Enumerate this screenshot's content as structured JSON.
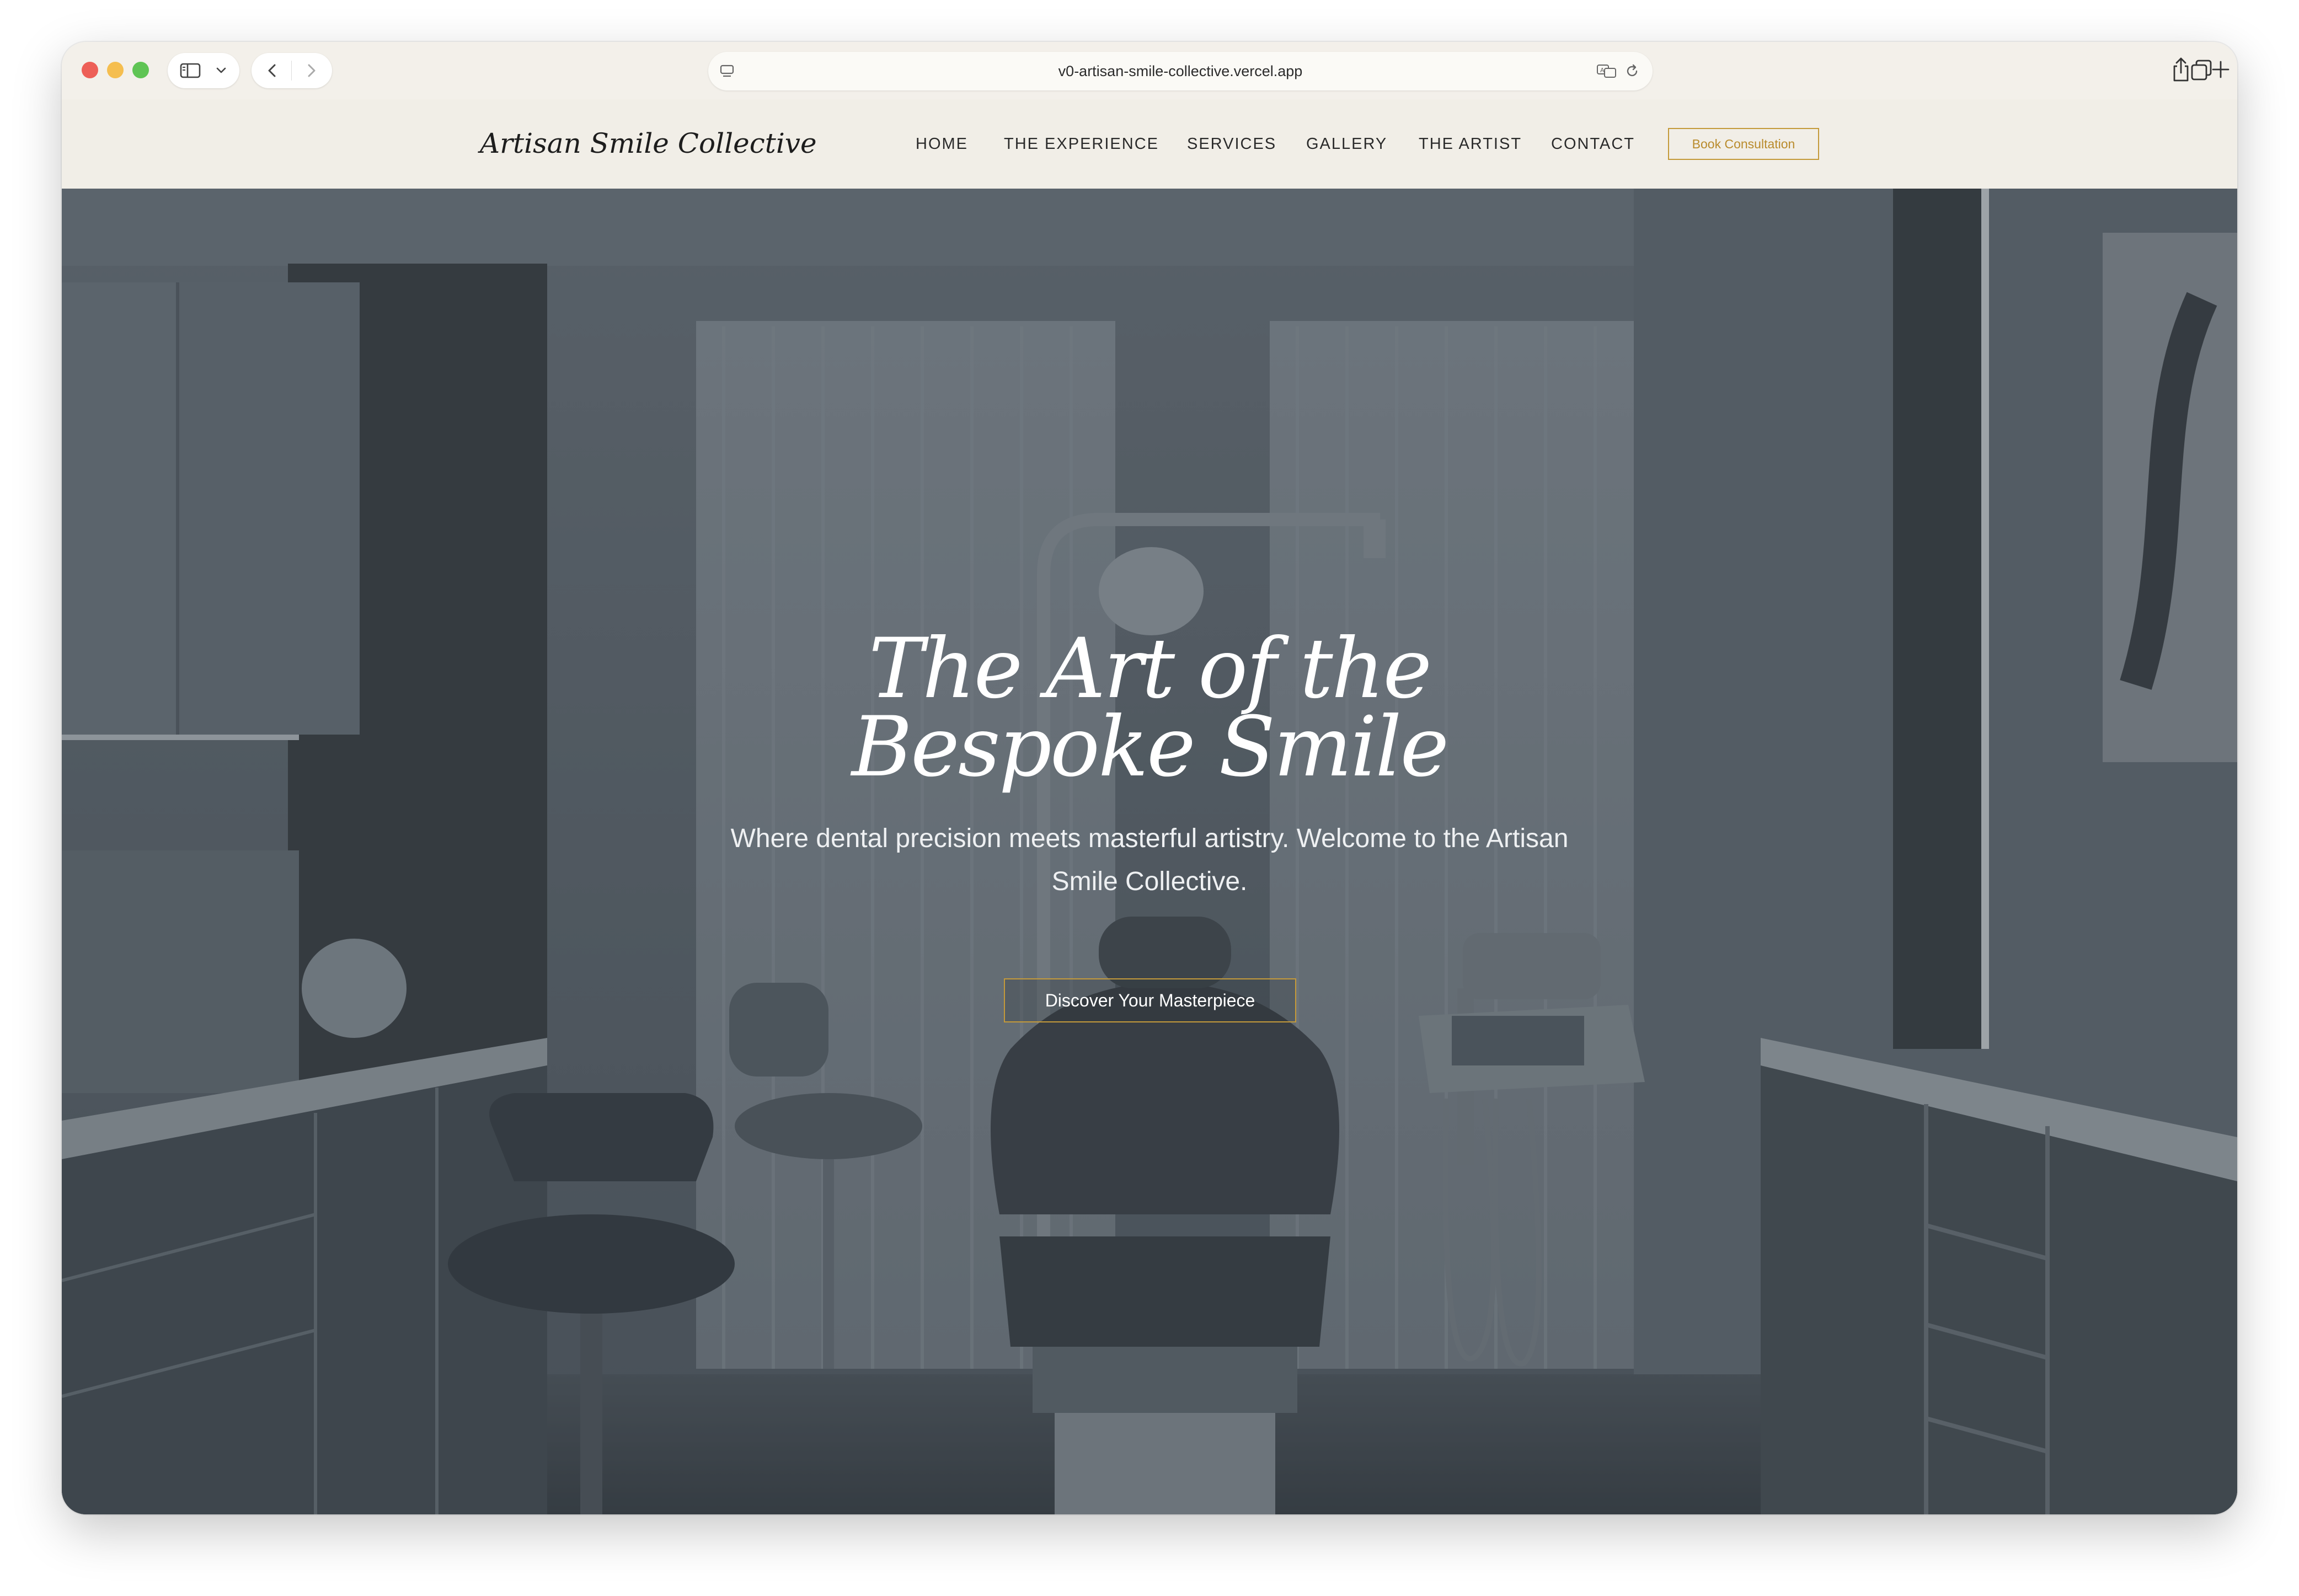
{
  "browser": {
    "url": "v0-artisan-smile-collective.vercel.app",
    "icons": {
      "sidebar": "sidebar-icon",
      "sidebar_menu": "chevron-down-icon",
      "back": "chevron-left-icon",
      "forward": "chevron-right-icon",
      "page": "page-menu-icon",
      "translate": "translate-icon",
      "reload": "reload-icon",
      "share": "share-icon",
      "new_tab": "plus-icon",
      "tabs": "tab-overview-icon"
    }
  },
  "site": {
    "logo": "Artisan Smile Collective",
    "nav": {
      "home": "HOME",
      "experience": "THE EXPERIENCE",
      "services": "SERVICES",
      "gallery": "GALLERY",
      "artist": "THE ARTIST",
      "contact": "CONTACT"
    },
    "book_button": "Book Consultation",
    "accent_color": "#c49a3a"
  },
  "hero": {
    "title_line1": "The Art of the",
    "title_line2": "Bespoke Smile",
    "subtitle": "Where dental precision meets masterful artistry. Welcome to the Artisan Smile Collective.",
    "cta": "Discover Your Masterpiece"
  }
}
